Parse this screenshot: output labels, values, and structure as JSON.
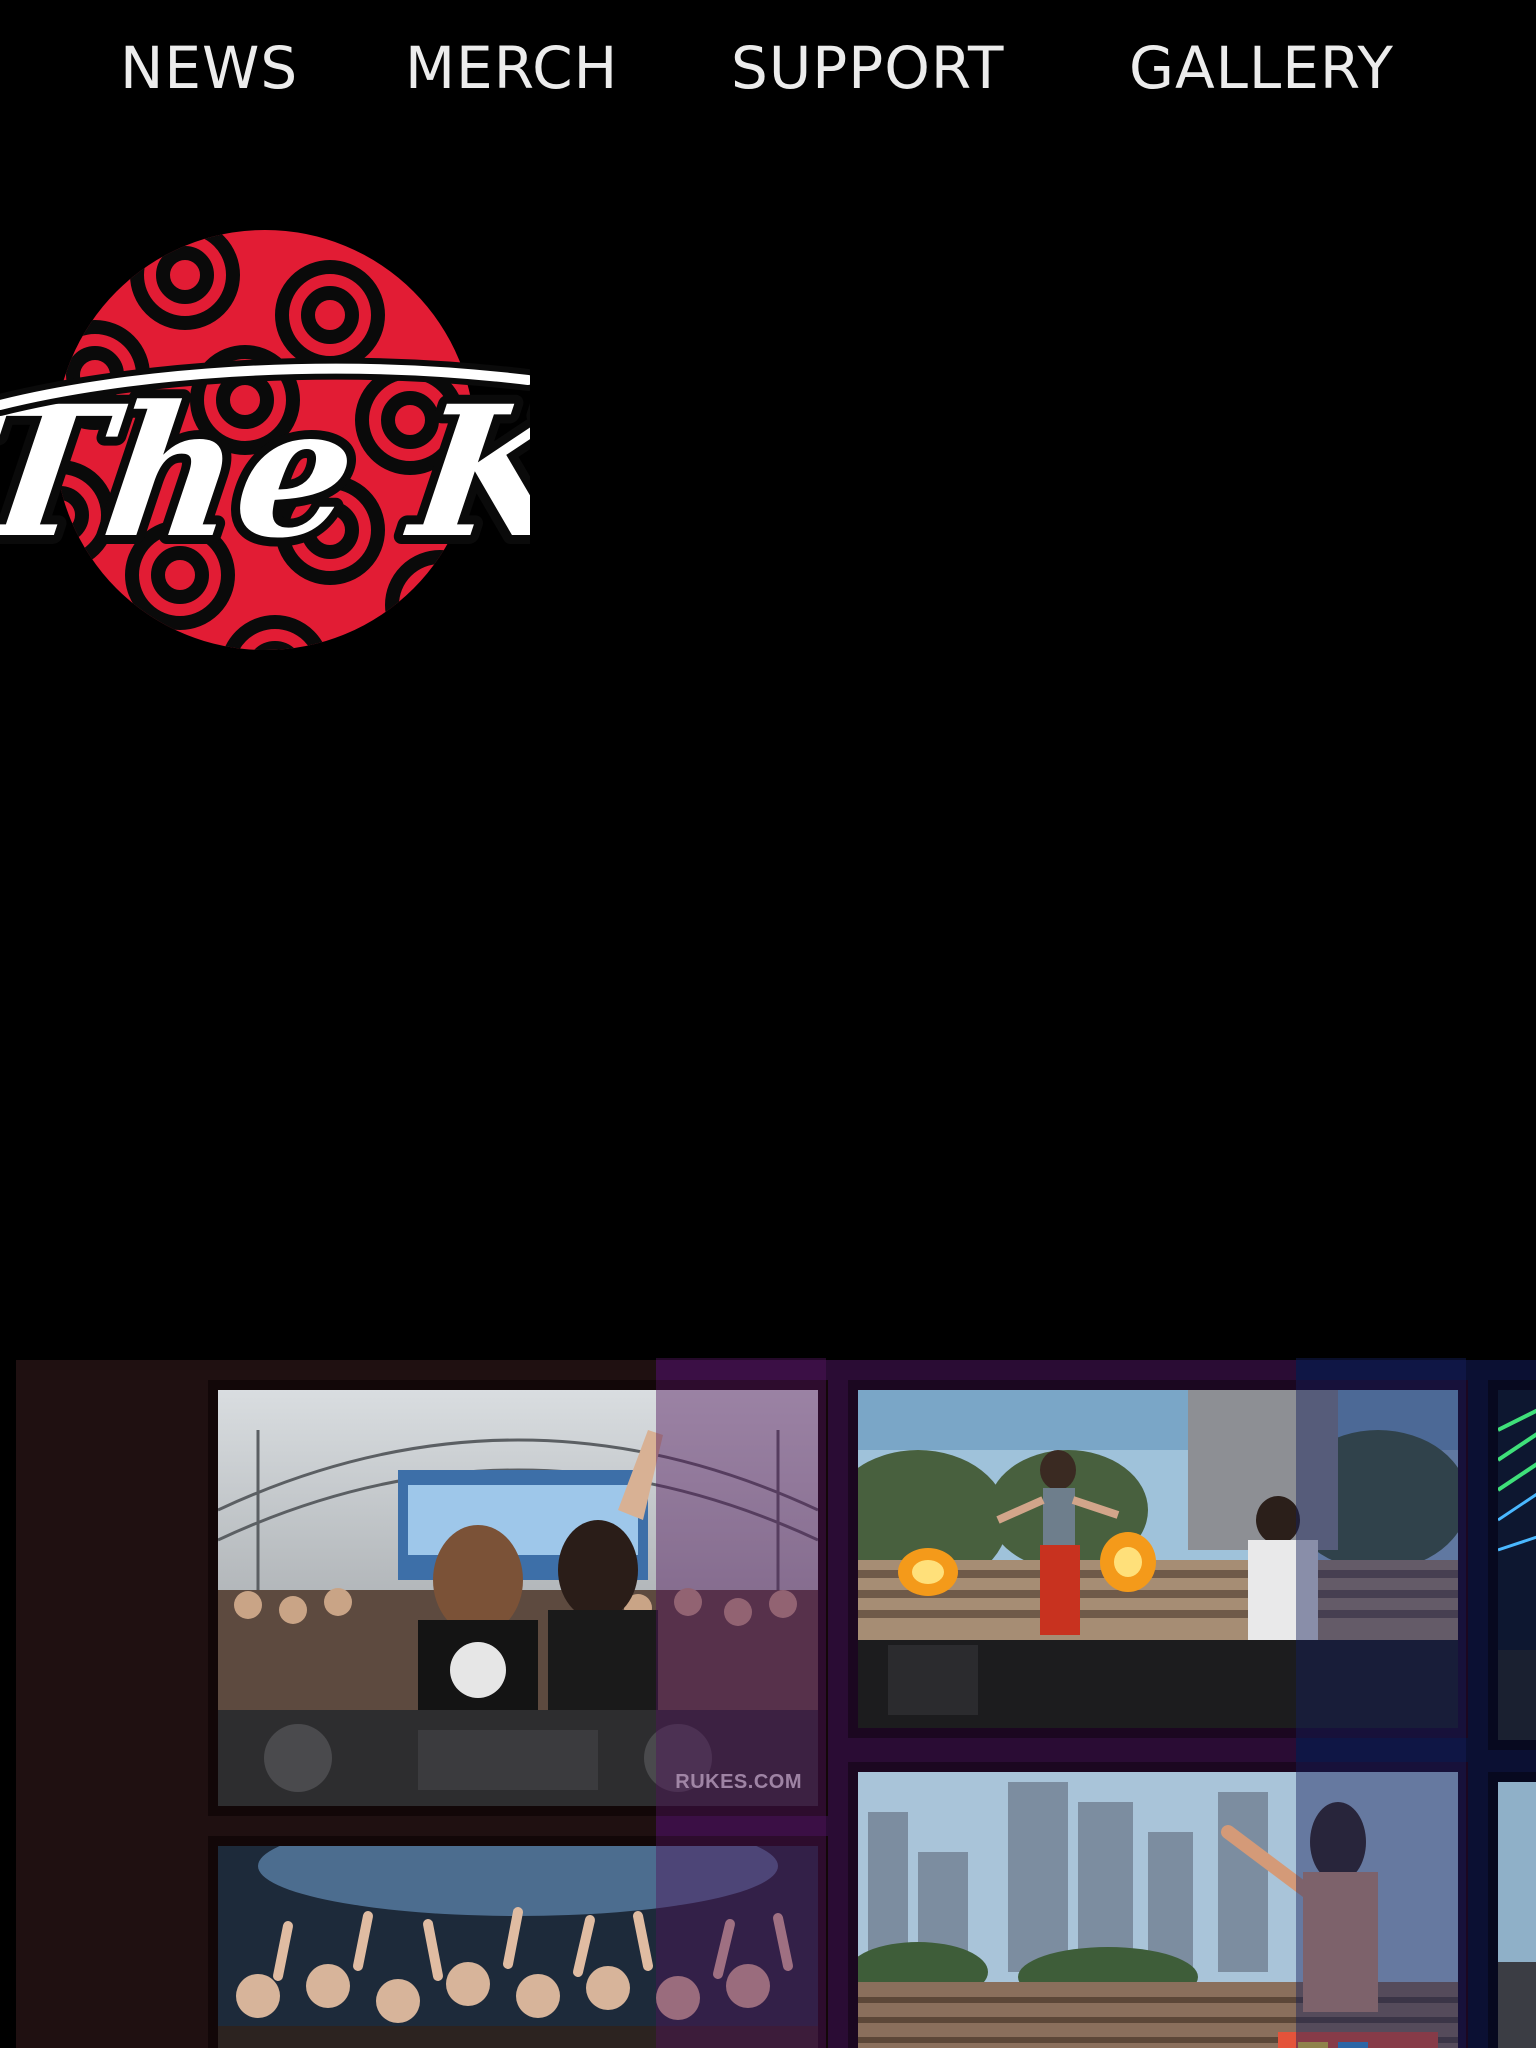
{
  "nav": {
    "items": [
      {
        "label": "NEWS"
      },
      {
        "label": "MERCH"
      },
      {
        "label": "SUPPORT"
      },
      {
        "label": "GALLERY"
      }
    ]
  },
  "logo": {
    "text": "The Kit",
    "colors": {
      "badge": "#e21c34",
      "rings": "#0a0a0a",
      "script": "#ffffff"
    }
  },
  "gallery": {
    "band_colors": [
      "#1f1011",
      "#2a0c34",
      "#0b1033"
    ],
    "photos": [
      {
        "subject": "dj-duo-stage",
        "watermark": "RUKES.COM"
      },
      {
        "subject": "festival-fire-stage"
      },
      {
        "subject": "laser-show"
      },
      {
        "subject": "crowd-hands-up"
      },
      {
        "subject": "city-skyline-crowd"
      },
      {
        "subject": "stage-side"
      }
    ]
  },
  "colors": {
    "background": "#000000",
    "nav_text": "#ececec"
  }
}
